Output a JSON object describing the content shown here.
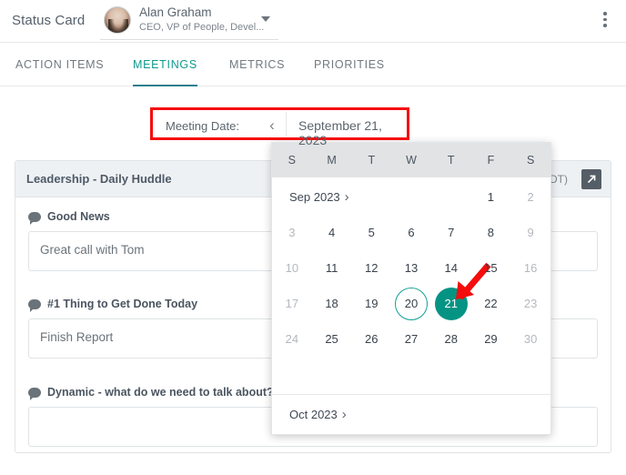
{
  "header": {
    "app_title": "Status Card",
    "user_name": "Alan Graham",
    "user_role": "CEO, VP of People, Devel...",
    "avatar_icon": "user-photo",
    "caret_icon": "chevron-down-icon",
    "kebab_icon": "more-vertical-icon"
  },
  "tabs": [
    {
      "label": "ACTION ITEMS",
      "active": false
    },
    {
      "label": "MEETINGS",
      "active": true
    },
    {
      "label": "METRICS",
      "active": false
    },
    {
      "label": "PRIORITIES",
      "active": false
    }
  ],
  "date_bar": {
    "label": "Meeting Date:",
    "prev_icon": "chevron-left-icon",
    "value": "September 21, 2023",
    "highlight_color": "#f50c0c"
  },
  "card": {
    "title": "Leadership - Daily Huddle",
    "time": "M (PDT)",
    "expand_icon": "open-in-new-icon",
    "fields": [
      {
        "label": "Good News",
        "icon": "comment-bubble-icon",
        "value": "Great call with Tom"
      },
      {
        "label": "#1 Thing to Get Done Today",
        "icon": "comment-bubble-icon",
        "value": "Finish Report"
      },
      {
        "label": "Dynamic - what do we need to talk about? Pri",
        "icon": "comment-bubble-icon",
        "value": ""
      }
    ]
  },
  "calendar": {
    "accent_color": "#059384",
    "today_ring_color": "#12a195",
    "weekdays": [
      "S",
      "M",
      "T",
      "W",
      "T",
      "F",
      "S"
    ],
    "months": [
      {
        "label": "Sep 2023",
        "chevron_icon": "chevron-right-icon",
        "rows": [
          [
            {
              "n": "",
              "state": "empty"
            },
            {
              "n": "",
              "state": "empty"
            },
            {
              "n": "",
              "state": "empty"
            },
            {
              "n": "",
              "state": "empty"
            },
            {
              "n": "",
              "state": "empty"
            },
            {
              "n": "1",
              "state": "normal"
            },
            {
              "n": "2",
              "state": "muted"
            }
          ],
          [
            {
              "n": "3",
              "state": "muted"
            },
            {
              "n": "4",
              "state": "normal"
            },
            {
              "n": "5",
              "state": "normal"
            },
            {
              "n": "6",
              "state": "normal"
            },
            {
              "n": "7",
              "state": "normal"
            },
            {
              "n": "8",
              "state": "normal"
            },
            {
              "n": "9",
              "state": "muted"
            }
          ],
          [
            {
              "n": "10",
              "state": "muted"
            },
            {
              "n": "11",
              "state": "normal"
            },
            {
              "n": "12",
              "state": "normal"
            },
            {
              "n": "13",
              "state": "normal"
            },
            {
              "n": "14",
              "state": "normal"
            },
            {
              "n": "15",
              "state": "normal"
            },
            {
              "n": "16",
              "state": "muted"
            }
          ],
          [
            {
              "n": "17",
              "state": "muted"
            },
            {
              "n": "18",
              "state": "normal"
            },
            {
              "n": "19",
              "state": "normal"
            },
            {
              "n": "20",
              "state": "today"
            },
            {
              "n": "21",
              "state": "selected"
            },
            {
              "n": "22",
              "state": "normal"
            },
            {
              "n": "23",
              "state": "muted"
            }
          ],
          [
            {
              "n": "24",
              "state": "muted"
            },
            {
              "n": "25",
              "state": "normal"
            },
            {
              "n": "26",
              "state": "normal"
            },
            {
              "n": "27",
              "state": "normal"
            },
            {
              "n": "28",
              "state": "normal"
            },
            {
              "n": "29",
              "state": "normal"
            },
            {
              "n": "30",
              "state": "muted"
            }
          ]
        ]
      }
    ],
    "next_month": {
      "label": "Oct 2023",
      "chevron_icon": "chevron-right-icon"
    }
  },
  "annotation": {
    "arrow_icon": "red-arrow-pointer",
    "color": "#f50c0c"
  }
}
